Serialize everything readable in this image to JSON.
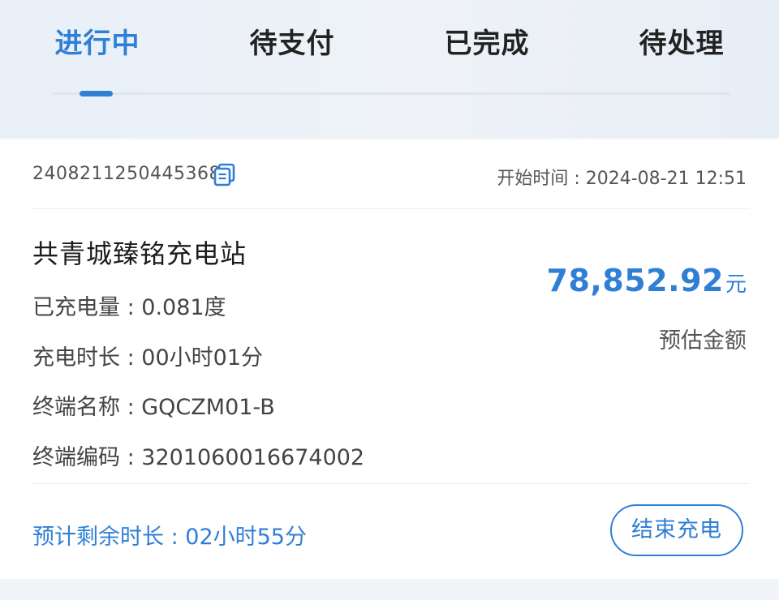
{
  "tabs": [
    {
      "label": "进行中",
      "active": true
    },
    {
      "label": "待支付",
      "active": false
    },
    {
      "label": "已完成",
      "active": false
    },
    {
      "label": "待处理",
      "active": false
    }
  ],
  "order": {
    "number": "2408211250445368",
    "start_time": "开始时间 : 2024-08-21 12:51",
    "station_name": "共青城臻铭充电站",
    "charged_energy": "已充电量 : 0.081度",
    "charge_duration": "充电时长 : 00小时01分",
    "terminal_name": "终端名称 : GQCZM01-B",
    "terminal_code": "终端编码 : 3201060016674002",
    "amount": "78,852.92",
    "amount_unit": "元",
    "amount_label": "预估金额",
    "remaining": "预计剩余时长 : 02小时55分",
    "end_button": "结束充电"
  },
  "colors": {
    "accent": "#2f7fd6",
    "text": "#222222",
    "muted": "#555555",
    "background": "#f1f4f8"
  },
  "icons": {
    "copy": "copy-icon"
  }
}
